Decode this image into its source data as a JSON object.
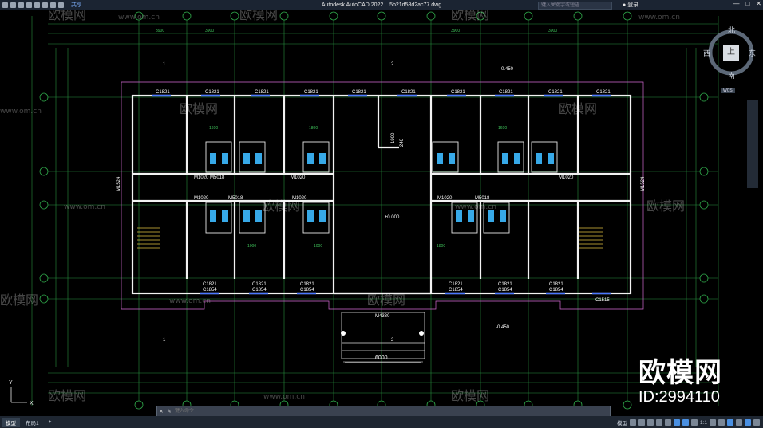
{
  "titlebar": {
    "app_title": "Autodesk AutoCAD 2022",
    "file_name": "5b21d58d2ac77.dwg",
    "share": "共享",
    "search_placeholder": "键入关键字或短语",
    "login": "登录"
  },
  "compass": {
    "north": "北",
    "south": "南",
    "east": "东",
    "west": "西",
    "top": "上",
    "wcs": "WCS"
  },
  "statusbar": {
    "tab_model": "模型",
    "tab_layout": "布局1",
    "add_tab": "+",
    "model_label": "模型",
    "scale": "1:1"
  },
  "command": {
    "placeholder": "键入命令"
  },
  "watermark": {
    "brand": "欧模网",
    "id": "ID:2994110",
    "tile_text": "欧模网",
    "tile_url": "www.om.cn"
  },
  "drawing": {
    "top_window": "C1821",
    "bottom_window_upper": "C1821",
    "bottom_window_lower": "C1854",
    "corner_window": "C1515",
    "door_m5018": "M5018",
    "door_m1020": "M1020",
    "door_m1524": "M1524",
    "main_door": "M4330",
    "elev_neg_top": "-0.450",
    "elev_zero": "±0.000",
    "elev_neg_bottom": "-0.450",
    "entrance_width": "6000",
    "dim_1900": "1900",
    "dim_240": "240",
    "dim_1600": "1600",
    "dim_1800": "1800",
    "dim_1000": "1000",
    "dim_3900": "3900",
    "section_1": "1",
    "section_2": "2",
    "ucs_y": "Y",
    "ucs_x": "X"
  }
}
